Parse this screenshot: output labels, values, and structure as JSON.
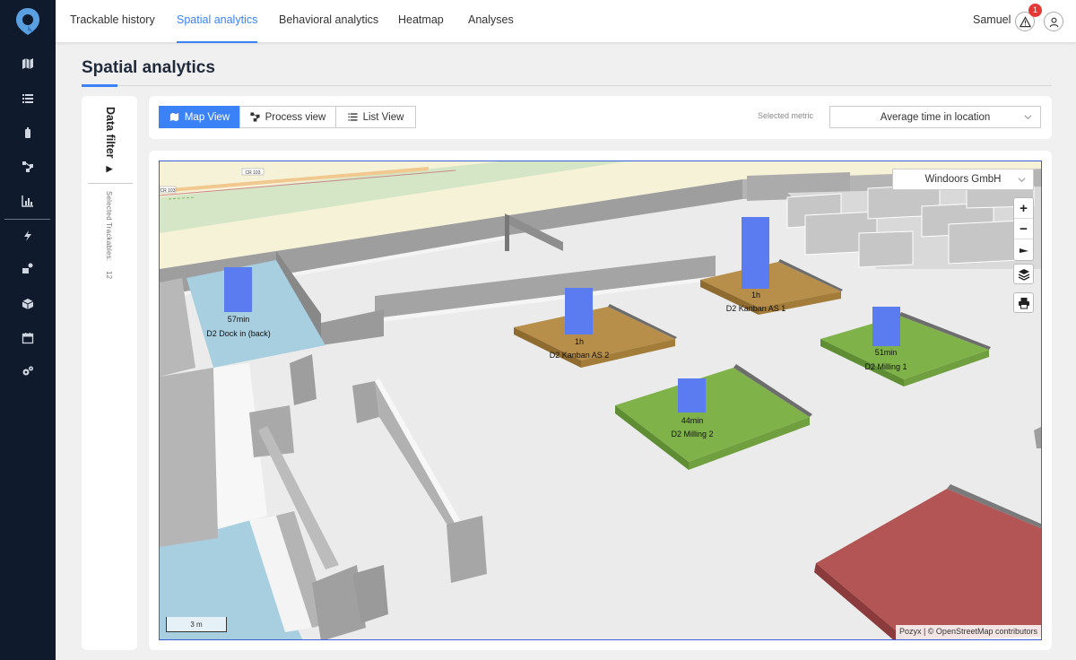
{
  "nav": {
    "tabs": [
      {
        "label": "Trackable history"
      },
      {
        "label": "Spatial analytics"
      },
      {
        "label": "Behavioral analytics"
      },
      {
        "label": "Heatmap"
      },
      {
        "label": "Analyses"
      }
    ],
    "active_tab": "Spatial analytics",
    "user": "Samuel",
    "alert_count": "1"
  },
  "sidebar": {
    "icons": [
      "map-icon",
      "list-icon",
      "tag-icon",
      "process-icon",
      "chart-icon",
      "bolt-icon",
      "settings-cog-icon",
      "cube-icon",
      "calendar-icon",
      "cogs-icon"
    ]
  },
  "page": {
    "title": "Spatial analytics"
  },
  "filter": {
    "label": "Data filter",
    "selected_text": "Selected Trackables:",
    "selected_count": "12"
  },
  "toolbar": {
    "views": [
      {
        "label": "Map View"
      },
      {
        "label": "Process view"
      },
      {
        "label": "List View"
      }
    ],
    "active_view": "Map View",
    "metric_label": "Selected metric",
    "metric_value": "Average time in location"
  },
  "map": {
    "organization": "Windoors GmbH",
    "scale_label": "3 m",
    "attribution": "Pozyx | © OpenStreetMap contributors",
    "road_label": "CR 103",
    "road_label_2": "CR 103",
    "locations": [
      {
        "name": "D2 Dock in (back)",
        "value": "57min"
      },
      {
        "name": "D2 Kanban AS 2",
        "value": "1h"
      },
      {
        "name": "D2 Kanban AS 1",
        "value": "1h"
      },
      {
        "name": "D2 Milling 1",
        "value": "51min"
      },
      {
        "name": "D2 Milling 2",
        "value": "44min"
      }
    ]
  },
  "colors": {
    "accent": "#3b82f6",
    "sidebar": "#0f1b2d",
    "zone_blue": "#a8cfe0",
    "zone_kanban": "#b88f4a",
    "zone_milling": "#7fb34a",
    "zone_red": "#b35555",
    "bar": "#5b7bf0"
  }
}
